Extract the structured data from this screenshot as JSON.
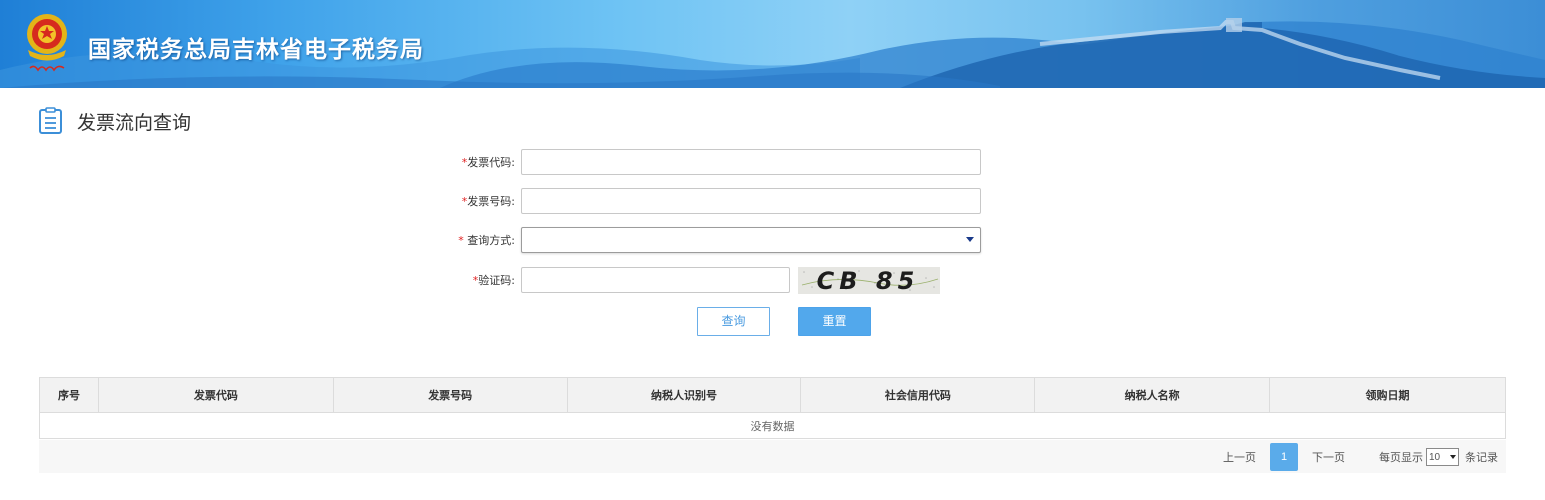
{
  "header": {
    "title": "国家税务总局吉林省电子税务局",
    "emblem": "tax-emblem-icon"
  },
  "page": {
    "title": "发票流向查询",
    "title_icon": "document-list-icon"
  },
  "form": {
    "required_mark": "*",
    "invoice_code": {
      "label": "发票代码:",
      "value": "",
      "placeholder": ""
    },
    "invoice_number": {
      "label": "发票号码:",
      "value": "",
      "placeholder": ""
    },
    "query_method": {
      "label": " 查询方式:",
      "selected": ""
    },
    "captcha": {
      "label": "验证码:",
      "value": "",
      "placeholder": "",
      "image_text": "CB 85"
    },
    "query_button": "查询",
    "reset_button": "重置"
  },
  "table": {
    "columns": [
      "序号",
      "发票代码",
      "发票号码",
      "纳税人识别号",
      "社会信用代码",
      "纳税人名称",
      "领购日期"
    ],
    "empty_text": "没有数据"
  },
  "pager": {
    "prev": "上一页",
    "current_page": "1",
    "next": "下一页",
    "per_page_label": "每页显示",
    "per_page_value": "10",
    "records_label": "条记录"
  },
  "colors": {
    "accent": "#52a8ec",
    "required": "#e02020",
    "header_sky": "#6ec3f4"
  }
}
